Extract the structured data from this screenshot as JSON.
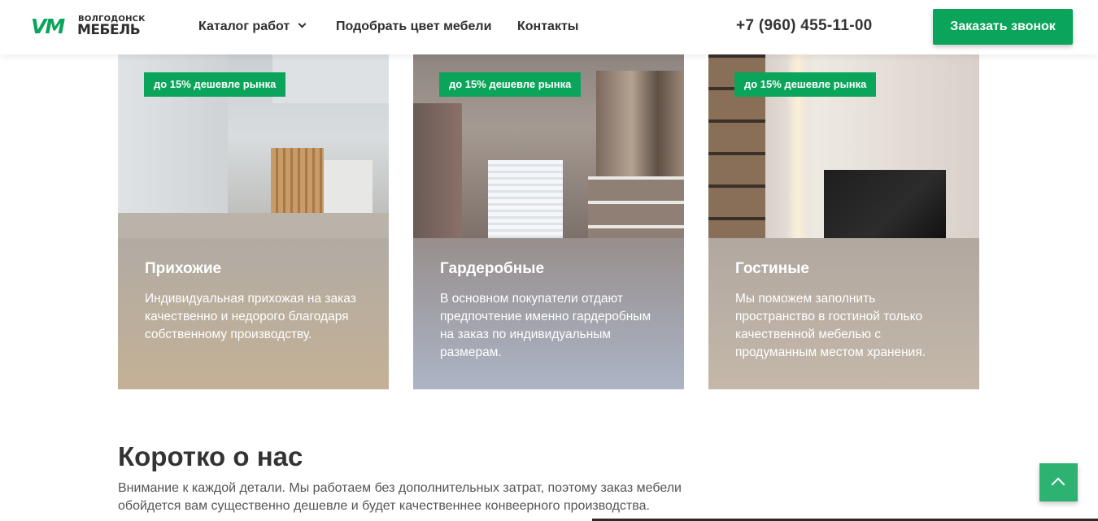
{
  "header": {
    "logo": {
      "mark": "VM",
      "city": "ВОЛГОДОНСК",
      "name": "МЕБЕЛЬ"
    },
    "nav": [
      {
        "label": "Каталог работ",
        "has_dropdown": true
      },
      {
        "label": "Подобрать цвет мебели"
      },
      {
        "label": "Контакты"
      }
    ],
    "phone": "+7 (960) 455-11-00",
    "cta_label": "Заказать звонок"
  },
  "cards": [
    {
      "badge": "до 15% дешевле рынка",
      "title": "Прихожие",
      "text": "Индивидуальная прихожая на заказ качественно и недорого благодаря собственному производству."
    },
    {
      "badge": "до 15% дешевле рынка",
      "title": "Гардеробные",
      "text": "В основном покупатели отдают предпочтение именно гардеробным на заказ по индивидуальным размерам."
    },
    {
      "badge": "до 15% дешевле рынка",
      "title": "Гостиные",
      "text": "Мы поможем заполнить пространство в гостиной только качественной мебелью с продуманным местом хранения."
    }
  ],
  "about": {
    "title": "Коротко о нас",
    "text": "Внимание к каждой детали. Мы работаем без дополнительных затрат, поэтому заказ мебели обойдется вам существенно дешевле и будет качественнее конвеерного производства."
  },
  "colors": {
    "accent": "#0aa55a",
    "text_dark": "#333333",
    "text_muted": "#555555"
  },
  "icons": {
    "dropdown": "chevron-down-icon",
    "scroll_top": "chevron-up-icon"
  }
}
